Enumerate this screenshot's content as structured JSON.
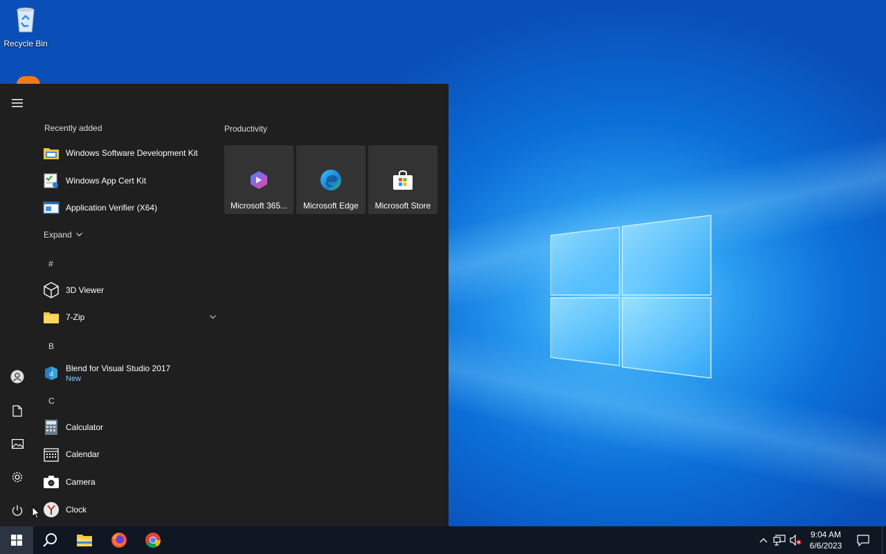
{
  "desktop": {
    "icons": [
      {
        "label": "Recycle Bin",
        "icon": "recycle-bin-icon"
      }
    ]
  },
  "start_menu": {
    "recently_added_title": "Recently added",
    "recently_added": [
      {
        "label": "Windows Software Development Kit",
        "icon": "folder-sdk-icon"
      },
      {
        "label": "Windows App Cert Kit",
        "icon": "cert-kit-icon"
      },
      {
        "label": "Application Verifier (X64)",
        "icon": "app-verifier-icon"
      }
    ],
    "expand_label": "Expand",
    "groups": [
      {
        "letter": "#",
        "apps": [
          {
            "label": "3D Viewer",
            "icon": "cube-icon"
          },
          {
            "label": "7-Zip",
            "icon": "folder-icon"
          }
        ]
      },
      {
        "letter": "B",
        "apps": [
          {
            "label": "Blend for Visual Studio 2017",
            "sub": "New",
            "icon": "blend-icon"
          }
        ]
      },
      {
        "letter": "C",
        "apps": [
          {
            "label": "Calculator",
            "icon": "calculator-icon"
          },
          {
            "label": "Calendar",
            "icon": "calendar-icon"
          },
          {
            "label": "Camera",
            "icon": "camera-icon"
          },
          {
            "label": "Clock",
            "icon": "clock-icon"
          }
        ]
      }
    ],
    "tiles_group_title": "Productivity",
    "tiles": [
      {
        "label": "Microsoft 365...",
        "icon": "microsoft-365-icon"
      },
      {
        "label": "Microsoft Edge",
        "icon": "edge-icon"
      },
      {
        "label": "Microsoft Store",
        "icon": "store-icon"
      }
    ],
    "rail_icons": [
      "hamburger-menu-icon",
      "user-icon",
      "document-icon",
      "pictures-icon",
      "settings-gear-icon",
      "power-icon"
    ]
  },
  "taskbar": {
    "apps": [
      "start-windows-icon",
      "search-icon",
      "file-explorer-icon",
      "firefox-icon",
      "chrome-icon"
    ],
    "time": "9:04 AM",
    "date": "6/6/2023",
    "tray_icons": [
      "show-hidden-chevron-icon",
      "network-icon",
      "volume-muted-icon",
      "notification-icon"
    ]
  },
  "colors": {
    "menu_bg": "#1f1f1f",
    "tile_bg": "#333333",
    "taskbar_bg": "#0e1722",
    "accent_sub": "#8fc8ff"
  }
}
